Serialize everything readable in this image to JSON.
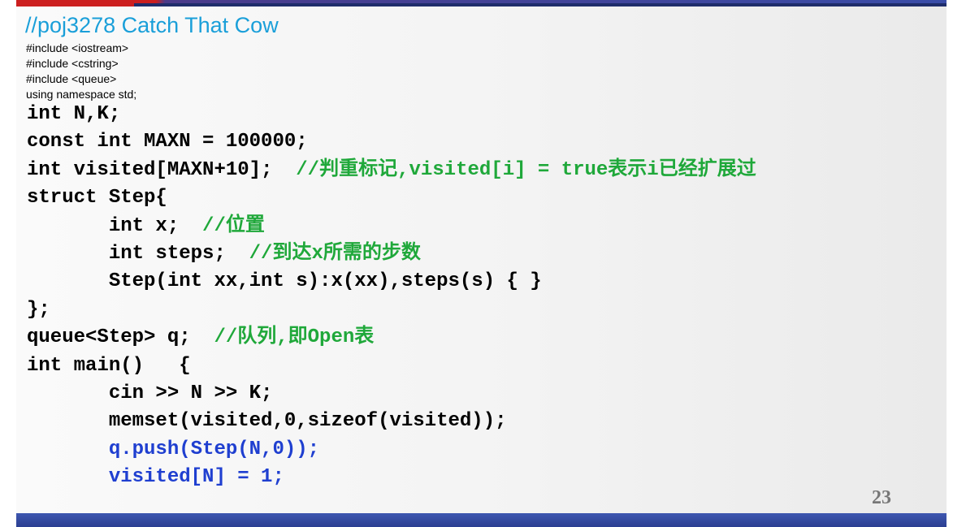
{
  "slide": {
    "title": "//poj3278 Catch That Cow",
    "includes": [
      "#include <iostream>",
      "#include <cstring>",
      "#include <queue>",
      "using namespace std;"
    ],
    "code_lines": [
      {
        "code": "int N,K;",
        "comment": ""
      },
      {
        "code": "const int MAXN = 100000;",
        "comment": ""
      },
      {
        "code": "int visited[MAXN+10];  ",
        "comment": "//判重标记,visited[i] = true表示i已经扩展过"
      },
      {
        "code": "struct Step{",
        "comment": ""
      },
      {
        "code": "       int x;  ",
        "comment": "//位置"
      },
      {
        "code": "       int steps;  ",
        "comment": "//到达x所需的步数"
      },
      {
        "code": "       Step(int xx,int s):x(xx),steps(s) { }",
        "comment": ""
      },
      {
        "code": "};",
        "comment": ""
      },
      {
        "code": "queue<Step> q;  ",
        "comment": "//队列,即Open表"
      },
      {
        "code": "int main()   {",
        "comment": ""
      },
      {
        "code": "       cin >> N >> K;",
        "comment": ""
      },
      {
        "code": "       memset(visited,0,sizeof(visited));",
        "comment": ""
      }
    ],
    "highlighted_lines": [
      "       q.push(Step(N,0));",
      "       visited[N] = 1;"
    ],
    "page_number": "23"
  },
  "colors": {
    "title": "#1a9fd9",
    "comment": "#1fa83a",
    "highlight": "#1f3fd0",
    "bottom_bar": "#2b3f91",
    "top_bar_red": "#cc1f1f"
  }
}
